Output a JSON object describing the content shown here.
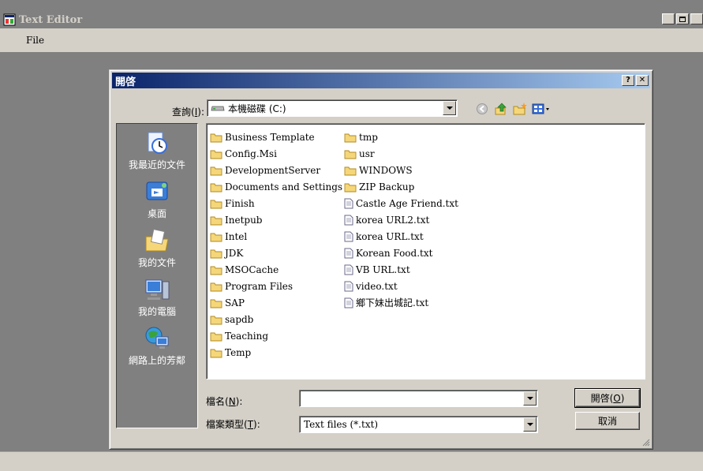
{
  "app": {
    "title": "Text Editor",
    "menu": {
      "file_label": "File"
    }
  },
  "dialog": {
    "title": "開啓",
    "help_label": "?",
    "close_label": "✕",
    "look_in": {
      "label_prefix": "查詢(",
      "label_key": "I",
      "label_suffix": "):",
      "value": "本機磁碟 (C:)"
    },
    "places": [
      {
        "label": "我最近的文件",
        "icon": "recent-documents-icon"
      },
      {
        "label": "桌面",
        "icon": "desktop-icon"
      },
      {
        "label": "我的文件",
        "icon": "my-documents-icon"
      },
      {
        "label": "我的電腦",
        "icon": "my-computer-icon"
      },
      {
        "label": "網路上的芳鄰",
        "icon": "network-places-icon"
      }
    ],
    "folders": [
      "Business Template",
      "Config.Msi",
      "DevelopmentServer",
      "Documents and Settings",
      "Finish",
      "Inetpub",
      "Intel",
      "JDK",
      "MSOCache",
      "Program Files",
      "SAP",
      "sapdb",
      "Teaching",
      "Temp",
      "tmp",
      "usr",
      "WINDOWS",
      "ZIP Backup"
    ],
    "files": [
      "Castle Age Friend.txt",
      "korea URL2.txt",
      "korea URL.txt",
      "Korean Food.txt",
      "VB URL.txt",
      "video.txt",
      "鄉下妹出城記.txt"
    ],
    "file_name": {
      "label_prefix": "檔名(",
      "label_key": "N",
      "label_suffix": "):",
      "value": ""
    },
    "file_type": {
      "label_prefix": "檔案類型(",
      "label_key": "T",
      "label_suffix": "):",
      "value": "Text files (*.txt)"
    },
    "open_button": {
      "label_prefix": "開啓(",
      "label_key": "O",
      "label_suffix": ")"
    },
    "cancel_button": {
      "label": "取消"
    }
  },
  "colors": {
    "folder": "#f5d77a",
    "title_active_start": "#0a246a",
    "title_active_end": "#a6caf0",
    "face": "#d4d0c8"
  }
}
